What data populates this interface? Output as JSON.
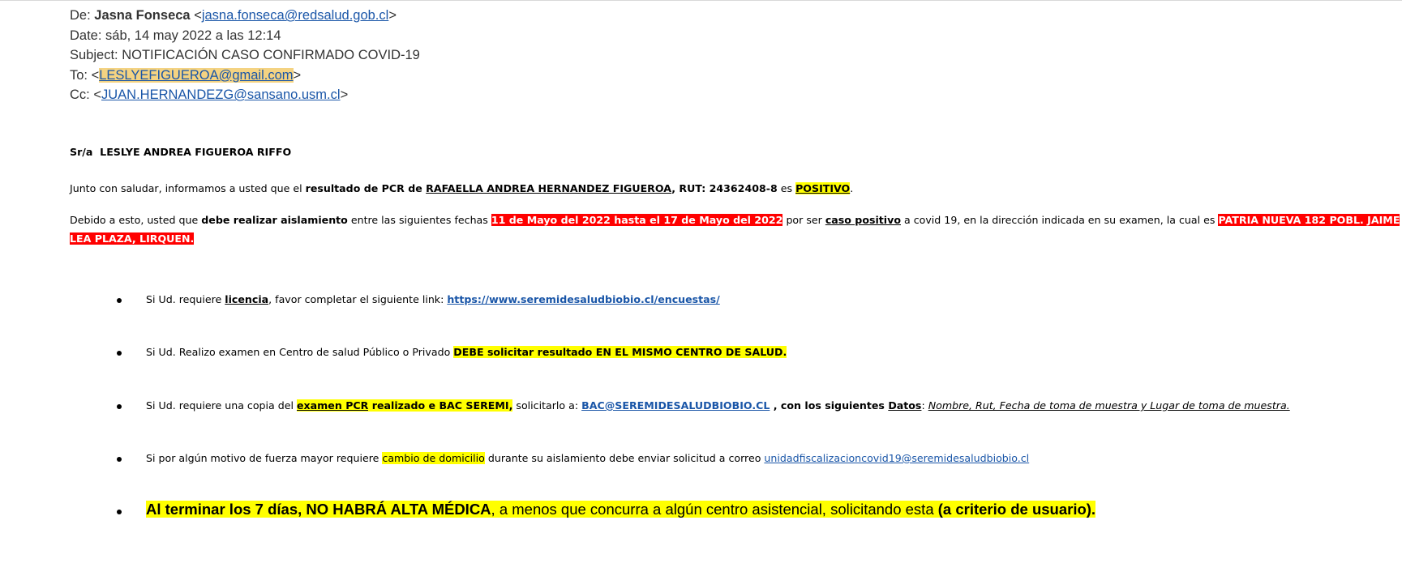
{
  "header": {
    "from_label": "De:",
    "from_name": "Jasna Fonseca",
    "from_email": "jasna.fonseca@redsalud.gob.cl",
    "date_label": "Date:",
    "date_value": "sáb, 14 may 2022 a las 12:14",
    "subject_label": "Subject:",
    "subject_value": "NOTIFICACIÓN CASO CONFIRMADO COVID-19",
    "to_label": "To:",
    "to_email": "LESLYEFIGUEROA@gmail.com",
    "cc_label": "Cc:",
    "cc_email": "JUAN.HERNANDEZG@sansano.usm.cl"
  },
  "body": {
    "greeting_prefix": "Sr/a",
    "greeting_name": "LESLYE ANDREA FIGUEROA RIFFO",
    "p1": {
      "t1": "Junto con saludar, informamos a usted que el ",
      "t2": "resultado de PCR de ",
      "t3": "RAFAELLA ANDREA HERNANDEZ FIGUEROA",
      "t4": ", RUT: 24362408-8",
      "t5": " es ",
      "t6": "POSITIVO",
      "t7": "."
    },
    "p2": {
      "t1": "Debido a esto, usted que ",
      "t2": "debe realizar aislamiento",
      "t3": "  entre las siguientes fechas ",
      "t4": "11 de Mayo del 2022 hasta el 17 de Mayo del 2022",
      "t5": " por ser ",
      "t6": "caso positivo",
      "t7": " a covid 19, en la dirección indicada en su examen, la cual es ",
      "t8": "PATRIA NUEVA 182 POBL. JAIME",
      "t9": "LEA PLAZA, LIRQUEN."
    },
    "bullets": [
      {
        "t1": "Si Ud. requiere ",
        "t2": "licencia",
        "t3": ", favor completar el siguiente link: ",
        "t4": "https://www.seremidesaludbiobio.cl/encuestas/"
      },
      {
        "t1": "Si Ud. Realizo examen en Centro  de salud Público o Privado ",
        "t2": "DEBE solicitar resultado  EN EL MISMO CENTRO DE SALUD."
      },
      {
        "t1": "Si Ud. requiere una copia del ",
        "t2": "examen PCR",
        "t3": " realizado e BAC SEREMI,",
        "t4": " solicitarlo a: ",
        "t5": "BAC@SEREMIDESALUDBIOBIO.CL",
        "t6": " , con los siguientes ",
        "t7": "Datos",
        "t8": ": ",
        "t9": "Nombre, Rut, Fecha de toma de muestra y Lugar de toma de muestra."
      },
      {
        "t1": "Si por algún motivo de fuerza mayor requiere ",
        "t2": "cambio de domicilio",
        "t3": " durante su aislamiento debe enviar solicitud a correo ",
        "t4": "unidadfiscalizacioncovid19@seremidesaludbiobio.cl"
      },
      {
        "t1": "Al terminar los 7 días, NO HABRÁ ALTA MÉDICA",
        "t2": ", a menos que concurra a algún centro asistencial, solicitando esta ",
        "t3": "(a criterio de usuario)."
      }
    ]
  }
}
